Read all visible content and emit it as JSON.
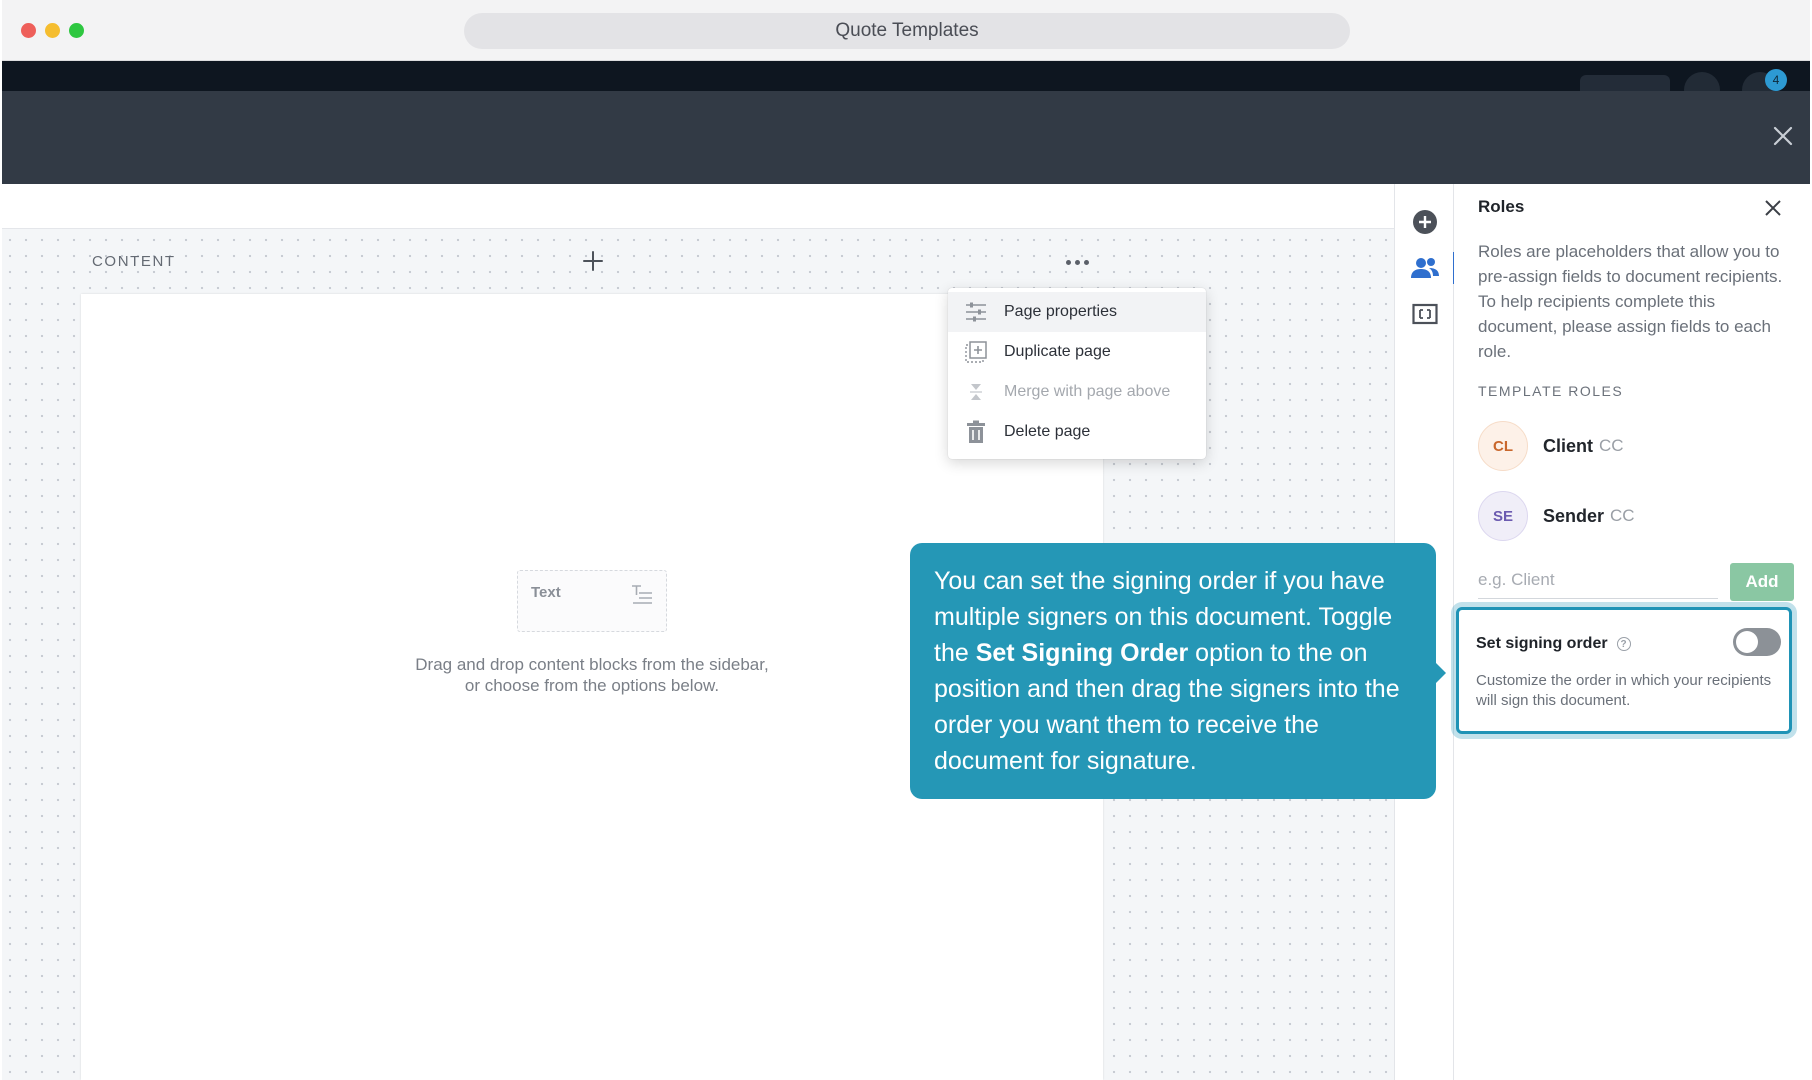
{
  "window": {
    "title": "Quote Templates"
  },
  "topbar": {
    "notification_count": "4"
  },
  "editor": {
    "content_label": "CONTENT",
    "text_block_label": "Text",
    "empty_hint_line1": "Drag and drop content blocks from the sidebar,",
    "empty_hint_line2": "or choose from the options below."
  },
  "page_menu": {
    "items": [
      {
        "label": "Page properties",
        "icon": "sliders-icon",
        "state": "hover"
      },
      {
        "label": "Duplicate page",
        "icon": "duplicate-icon",
        "state": "enabled"
      },
      {
        "label": "Merge with page above",
        "icon": "merge-icon",
        "state": "disabled"
      },
      {
        "label": "Delete page",
        "icon": "trash-icon",
        "state": "enabled"
      }
    ]
  },
  "roles_panel": {
    "title": "Roles",
    "description": "Roles are placeholders that allow you to pre-assign fields to document recipients. To help recipients complete this document, please assign fields to each role.",
    "section_label": "TEMPLATE ROLES",
    "roles": [
      {
        "initials": "CL",
        "name": "Client",
        "tag": "CC",
        "avatar_bg": "#fdf1e8",
        "avatar_fg": "#c9672c"
      },
      {
        "initials": "SE",
        "name": "Sender",
        "tag": "CC",
        "avatar_bg": "#f0eef8",
        "avatar_fg": "#6b5ab0"
      }
    ],
    "input_placeholder": "e.g. Client",
    "add_label": "Add",
    "signing_order": {
      "title": "Set signing order",
      "description": "Customize the order in which your recipients will sign this document.",
      "enabled": false
    }
  },
  "tooltip": {
    "part1": "You can set the signing order if you have multiple signers on this document. Toggle the ",
    "bold": "Set Signing Order",
    "part2": " option to the on position and then drag the signers into the order you want them to receive the document for signature."
  },
  "colors": {
    "accent_blue": "#2f6fce",
    "tooltip_teal": "#2597b6",
    "add_button_green": "#8ac7a3",
    "modal_header": "#323a45"
  }
}
